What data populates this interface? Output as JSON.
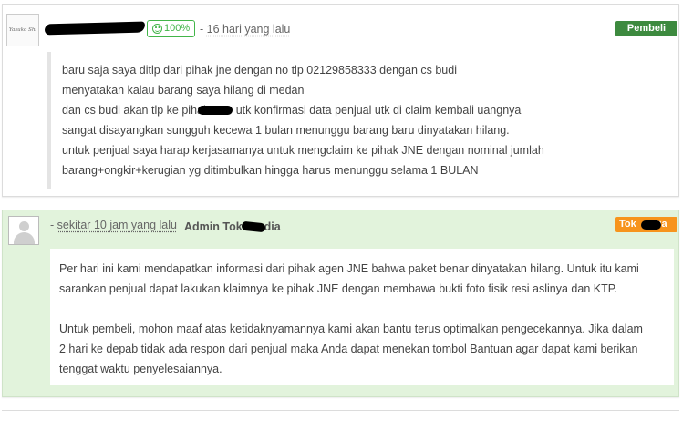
{
  "review": {
    "avatar_text": "Yasuko Shi",
    "rating": "100%",
    "time_sep": "-",
    "time": "16 hari yang lalu",
    "badge": "Pembeli",
    "lines": [
      "baru saja saya ditlp dari pihak jne dengan no tlp 02129858333 dengan cs budi",
      "menyatakan kalau barang saya hilang di medan",
      "dan cs budi akan tlp ke pihak",
      "utk konfirmasi data penjual utk di claim kembali uangnya",
      "sangat disayangkan sungguh kecewa 1 bulan menunggu barang baru dinyatakan hilang.",
      "untuk penjual saya harap kerjasamanya untuk mengclaim ke pihak JNE dengan nominal jumlah",
      "barang+ongkir+kerugian yg ditimbulkan hingga harus menunggu selama 1 BULAN"
    ]
  },
  "reply": {
    "time_sep": "-",
    "time": "sekitar 10 jam yang lalu",
    "admin_name_start": "Admin Tok",
    "admin_name_end": "dia",
    "badge_start": "Tok",
    "badge_end": "dia",
    "paragraph1": [
      "Per hari ini kami mendapatkan informasi dari pihak agen JNE bahwa paket benar dinyatakan hilang. Untuk itu kami",
      "sarankan penjual dapat lakukan klaimnya ke pihak JNE dengan membawa bukti foto fisik resi aslinya dan KTP."
    ],
    "paragraph2": [
      "Untuk pembeli, mohon maaf atas ketidaknyamannya kami akan bantu terus optimalkan pengecekannya. Jika dalam",
      "2 hari ke depab tidak ada respon dari penjual maka Anda dapat menekan tombol Bantuan agar dapat kami berikan",
      "tenggat waktu penyelesaiannya."
    ]
  }
}
